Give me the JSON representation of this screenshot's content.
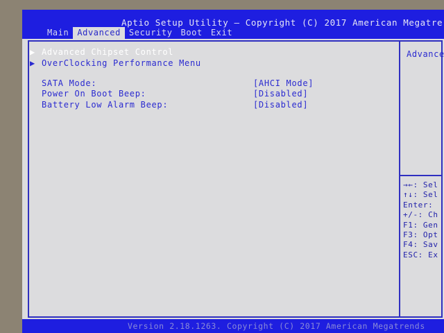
{
  "header": {
    "title": "Aptio Setup Utility – Copyright (C) 2017 American Megatre",
    "tabs": [
      {
        "label": "Main"
      },
      {
        "label": "Advanced"
      },
      {
        "label": "Security"
      },
      {
        "label": "Boot"
      },
      {
        "label": "Exit"
      }
    ],
    "active_tab": "Advanced"
  },
  "menu": {
    "submenus": [
      {
        "arrow": "▶",
        "label": "Advanced Chipset Control"
      },
      {
        "arrow": "▶",
        "label": "OverClocking Performance Menu"
      }
    ],
    "settings": [
      {
        "label": "SATA Mode:",
        "value": "[AHCI Mode]"
      },
      {
        "label": "Power On Boot Beep:",
        "value": "[Disabled]"
      },
      {
        "label": "Battery Low Alarm Beep:",
        "value": "[Disabled]"
      }
    ]
  },
  "help": {
    "title": "Advance",
    "keys": [
      "→←: Sel",
      "↑↓: Sel",
      "Enter:",
      "+/-: Ch",
      "F1: Gen",
      "F3: Opt",
      "F4: Sav",
      "ESC: Ex"
    ]
  },
  "footer": {
    "text": "Version 2.18.1263. Copyright (C) 2017 American Megatrends"
  },
  "colors": {
    "bar_blue": "#1e1ee0",
    "panel_gray": "#dcdcde",
    "text_blue": "#2a2ad0",
    "highlight_white": "#ffffff"
  }
}
